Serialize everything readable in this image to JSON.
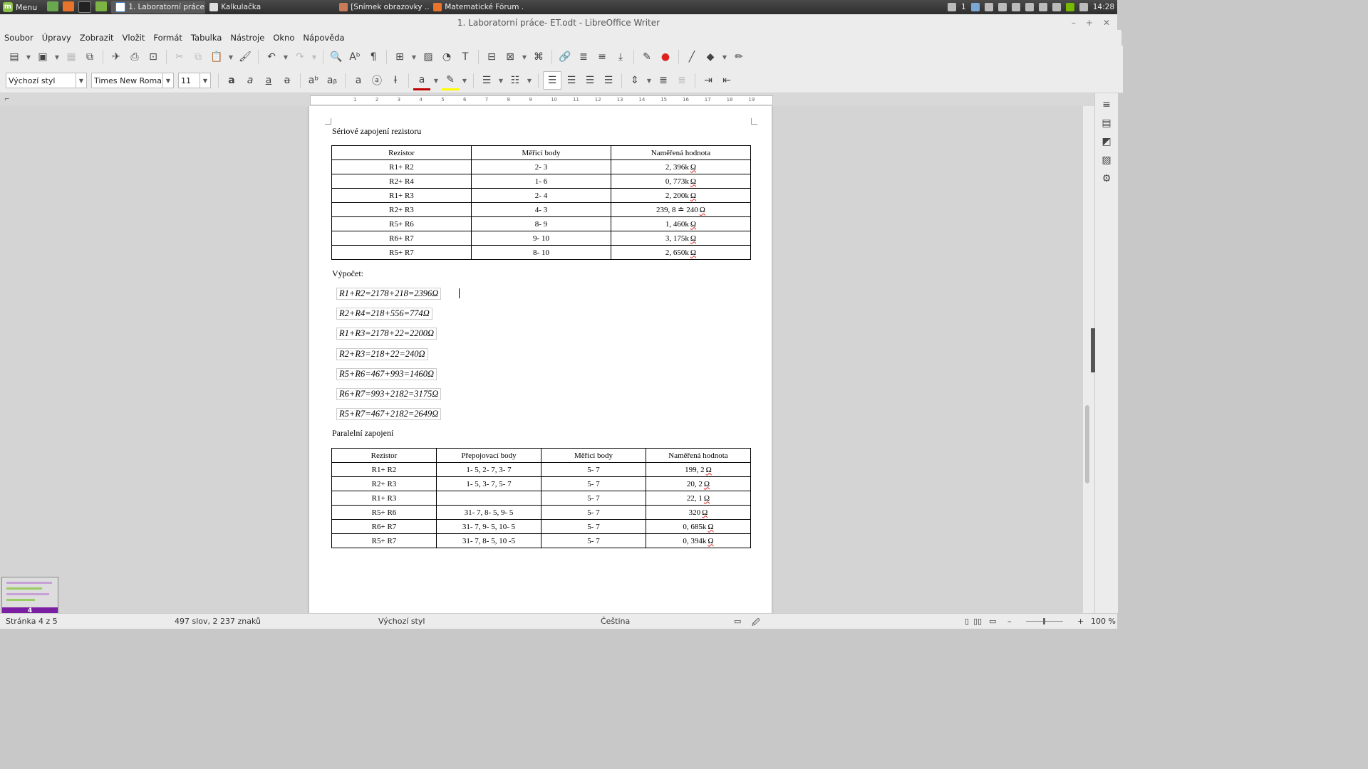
{
  "taskbar": {
    "menu_label": "Menu",
    "tasks": [
      {
        "label": "1. Laboratorní práce...",
        "active": true
      },
      {
        "label": "Kalkulačka",
        "active": false
      },
      {
        "label": "[Snímek obrazovky ...",
        "active": false
      },
      {
        "label": "Matematické Fórum ...",
        "active": false
      }
    ],
    "notifications": "1",
    "clock": "14:28"
  },
  "window": {
    "title": "1. Laboratorní práce- ET.odt - LibreOffice Writer",
    "minimize": "–",
    "maximize": "+",
    "close": "✕"
  },
  "menubar": {
    "items": [
      "Soubor",
      "Úpravy",
      "Zobrazit",
      "Vložit",
      "Formát",
      "Tabulka",
      "Nástroje",
      "Okno",
      "Nápověda"
    ]
  },
  "formatting": {
    "paragraph_style": "Výchozí styl",
    "font_name": "Times New Roman",
    "font_size": "11",
    "colors": {
      "font_color": "#c00000",
      "highlight": "#ffff00",
      "accent": "#7b1fa2"
    }
  },
  "ruler": {
    "numbers": [
      "1",
      "2",
      "3",
      "4",
      "5",
      "6",
      "7",
      "8",
      "9",
      "10",
      "11",
      "12",
      "13",
      "14",
      "15",
      "16",
      "17",
      "18",
      "19"
    ]
  },
  "document": {
    "heading_series": "Sériové zapojení rezistoru",
    "series_table": {
      "headers": [
        "Rezistor",
        "Měřicí body",
        "Naměřená hodnota"
      ],
      "rows": [
        [
          "R1+ R2",
          "2- 3",
          "2, 396k",
          "Ω"
        ],
        [
          "R2+ R4",
          "1- 6",
          "0, 773k",
          "Ω"
        ],
        [
          "R1+ R3",
          "2- 4",
          "2, 200k",
          "Ω"
        ],
        [
          "R2+ R3",
          "4- 3",
          "239, 8 ≐ 240",
          "Ω"
        ],
        [
          "R5+ R6",
          "8- 9",
          "1, 460k",
          "Ω"
        ],
        [
          "R6+ R7",
          "9- 10",
          "3, 175k",
          "Ω"
        ],
        [
          "R5+ R7",
          "8- 10",
          "2, 650k",
          "Ω"
        ]
      ]
    },
    "calc_label": "Výpočet:",
    "formulas": [
      "R1+R2=2178+218=2396Ω",
      "R2+R4=218+556=774Ω",
      "R1+R3=2178+22=2200Ω",
      "R2+R3=218+22=240Ω",
      "R5+R6=467+993=1460Ω",
      "R6+R7=993+2182=3175Ω",
      "R5+R7=467+2182=2649Ω"
    ],
    "heading_parallel": "Paralelní zapojení",
    "parallel_table": {
      "headers": [
        "Rezistor",
        "Přepojovací body",
        "Měřicí body",
        "Naměřená hodnota"
      ],
      "rows": [
        [
          "R1+ R2",
          "1- 5, 2- 7, 3- 7",
          "5- 7",
          "199, 2",
          "Ω"
        ],
        [
          "R2+ R3",
          "1- 5, 3- 7, 5- 7",
          "5- 7",
          "20, 2",
          "Ω"
        ],
        [
          "R1+ R3",
          "",
          "5- 7",
          "22, 1",
          "Ω"
        ],
        [
          "R5+ R6",
          "31- 7, 8- 5, 9- 5",
          "5- 7",
          "320",
          "Ω"
        ],
        [
          "R6+ R7",
          "31- 7, 9- 5, 10- 5",
          "5- 7",
          "0, 685k",
          "Ω"
        ],
        [
          "R5+ R7",
          "31- 7, 8- 5, 10 -5",
          "5- 7",
          "0, 394k",
          "Ω"
        ]
      ]
    }
  },
  "thumbnail": {
    "page_number": "4"
  },
  "statusbar": {
    "page": "Stránka 4 z 5",
    "words": "497 slov, 2 237 znaků",
    "style": "Výchozí styl",
    "language": "Čeština",
    "zoom": "100 %",
    "zoom_minus": "–",
    "zoom_plus": "+"
  }
}
